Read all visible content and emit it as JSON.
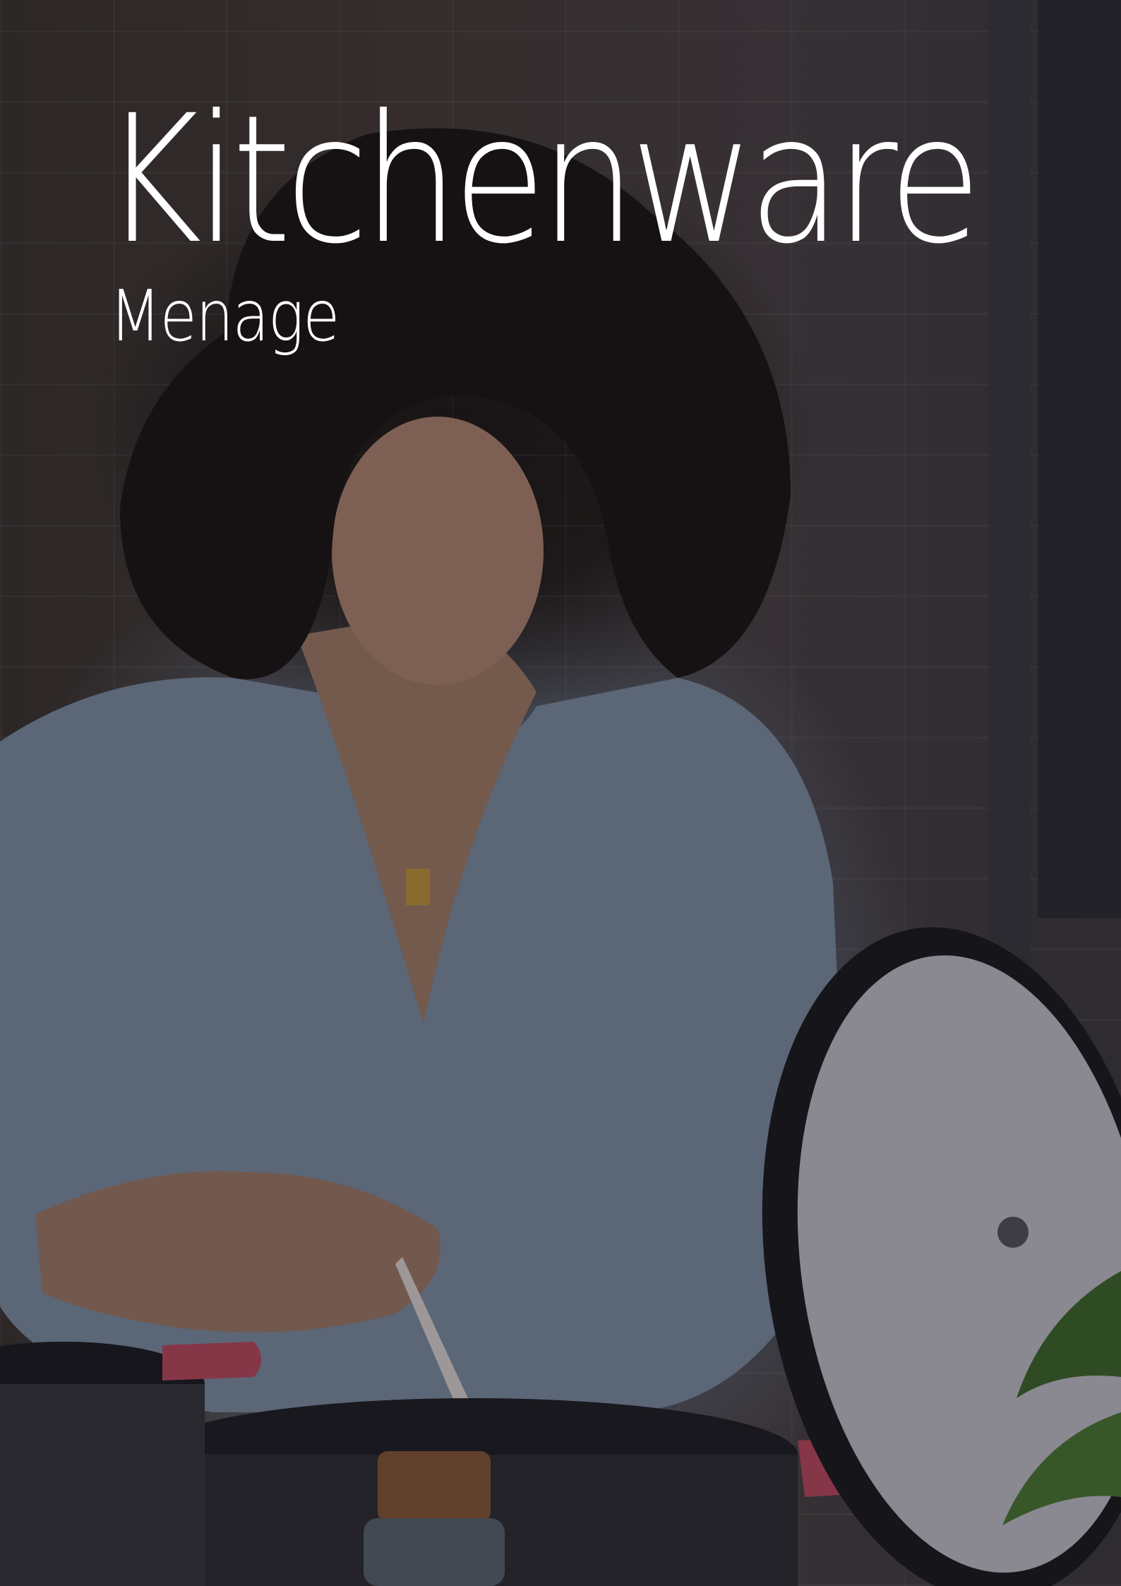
{
  "cover": {
    "title": "Kitchenware",
    "subtitle": "Menage"
  },
  "colors": {
    "text": "#ffffff",
    "overlay": "#141216"
  }
}
